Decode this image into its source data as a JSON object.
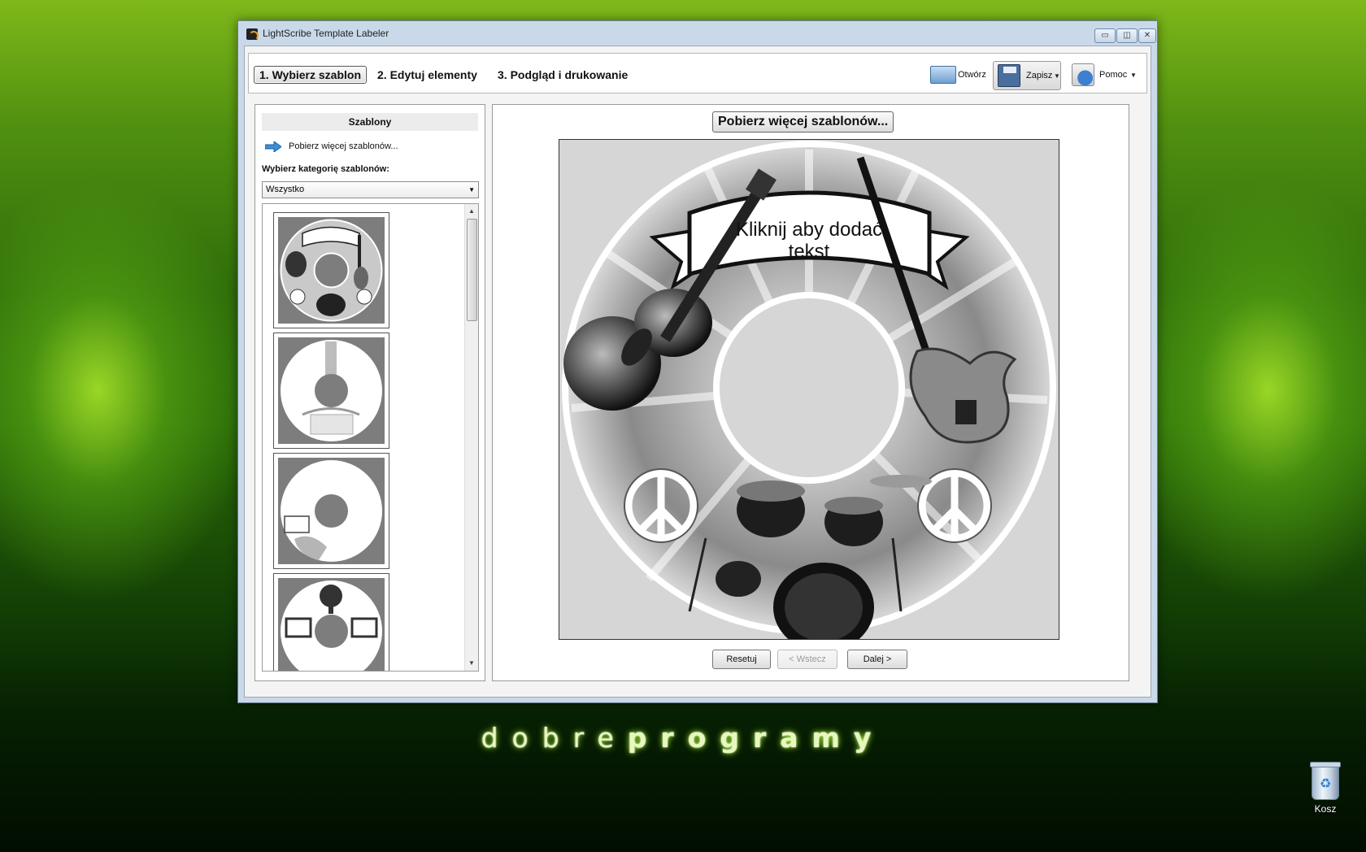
{
  "window": {
    "title": "LightScribe Template Labeler",
    "controls": {
      "minimize": "▭",
      "maximize": "◫",
      "close": "✕"
    }
  },
  "toolbar": {
    "steps": [
      {
        "label": "1. Wybierz szablon",
        "active": true
      },
      {
        "label": "2. Edytuj elementy",
        "active": false
      },
      {
        "label": "3. Podgląd i drukowanie",
        "active": false
      }
    ],
    "open_label": "Otwórz",
    "save_label": "Zapisz",
    "help_label": "Pomoc",
    "icons": {
      "open": "folder-icon",
      "save": "floppy-disk-icon",
      "help": "help-icon"
    }
  },
  "sidebar": {
    "header": "Szablony",
    "more_templates_link": "Pobierz więcej szablonów...",
    "category_label": "Wybierz kategorię szablonów:",
    "category_selected": "Wszystko",
    "templates": [
      {
        "name": "rock-template"
      },
      {
        "name": "tree-template"
      },
      {
        "name": "photo-template"
      },
      {
        "name": "frame-template"
      }
    ]
  },
  "main": {
    "more_templates_button": "Pobierz więcej szablonów...",
    "disc_text_line1": "Kliknij aby dodać",
    "disc_text_line2": "tekst",
    "buttons": {
      "reset": "Resetuj",
      "back": "< Wstecz",
      "next": "Dalej >"
    }
  },
  "desktop": {
    "brand_light": "dobre",
    "brand_bold": "programy",
    "recycle_bin_label": "Kosz"
  },
  "colors": {
    "accent_green": "#7dbd12",
    "window_frame": "#c9d9ea"
  }
}
